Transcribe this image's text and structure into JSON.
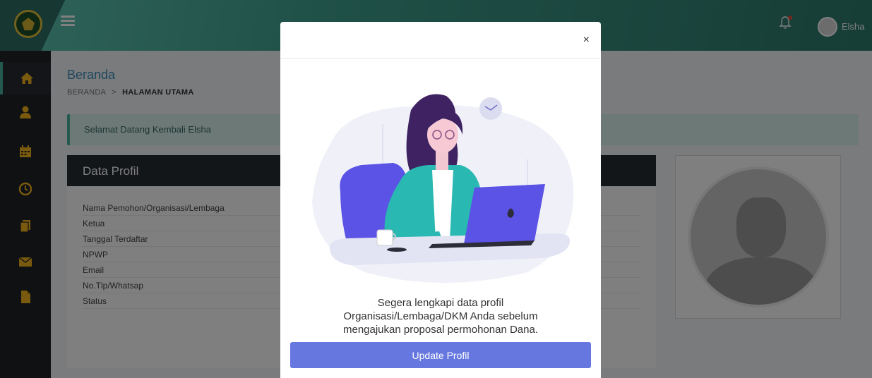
{
  "header": {
    "user_name": "Elsha"
  },
  "sidebar": {
    "items": [
      {
        "icon": "home-icon",
        "active": true
      },
      {
        "icon": "user-icon",
        "active": false
      },
      {
        "icon": "calendar-icon",
        "active": false
      },
      {
        "icon": "clock-icon",
        "active": false
      },
      {
        "icon": "copy-icon",
        "active": false
      },
      {
        "icon": "envelope-icon",
        "active": false
      },
      {
        "icon": "file-icon",
        "active": false
      }
    ]
  },
  "page": {
    "title": "Beranda",
    "breadcrumb_home": "BERANDA",
    "breadcrumb_separator": ">",
    "breadcrumb_current": "HALAMAN UTAMA",
    "welcome": "Selamat Datang Kembali Elsha"
  },
  "profile": {
    "title": "Data Profil",
    "rows": [
      "Nama Pemohon/Organisasi/Lembaga",
      "Ketua",
      "Tanggal Terdaftar",
      "NPWP",
      "Email",
      "No.Tlp/Whatsap",
      "Status"
    ]
  },
  "modal": {
    "close": "×",
    "message_lines": [
      "Segera lengkapi data profil",
      "Organisasi/Lembaga/DKM Anda sebelum",
      "mengajukan proposal permohonan Dana."
    ],
    "button": "Update Profil"
  },
  "colors": {
    "accent": "#46b39e",
    "button": "#6677e0",
    "sidebar": "#1e2226",
    "sidebar_icon": "#f2b51d"
  }
}
